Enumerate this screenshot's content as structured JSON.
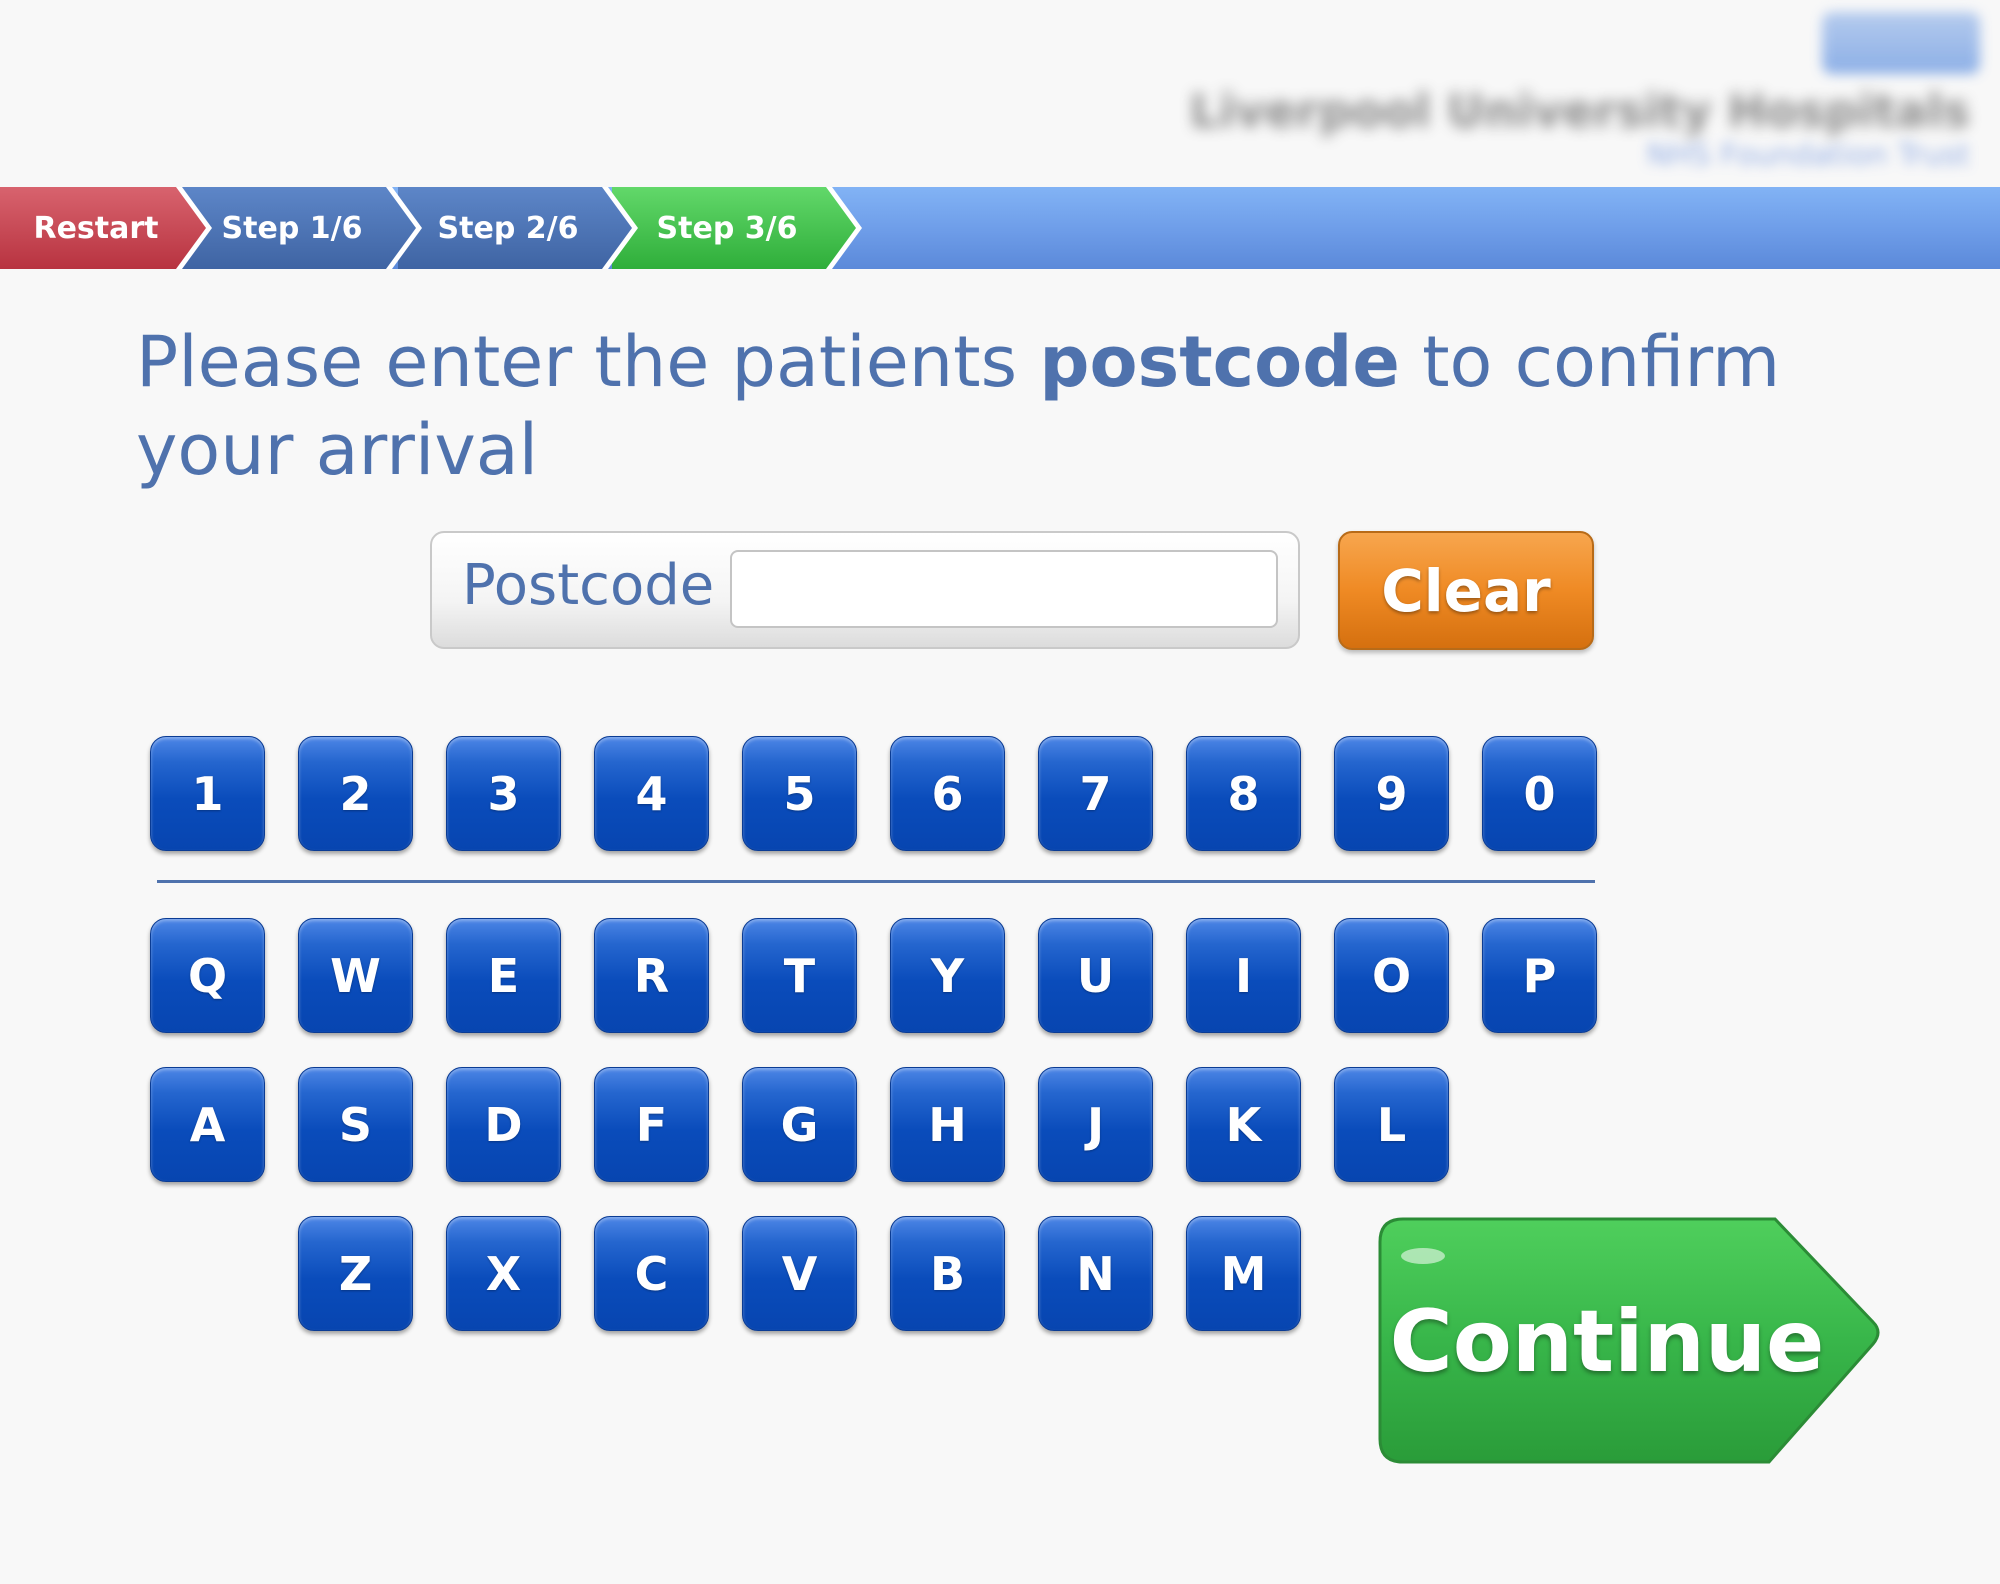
{
  "header": {
    "org_name": "Liverpool University Hospitals",
    "org_sub": "NHS Foundation Trust"
  },
  "steps": {
    "restart": "Restart",
    "step1": "Step 1/6",
    "step2": "Step 2/6",
    "step3": "Step 3/6",
    "current": "Step 3/6"
  },
  "heading": {
    "before": "Please enter the patients ",
    "emphasis": "postcode",
    "after": " to confirm your arrival"
  },
  "postcode": {
    "label": "Postcode",
    "value": ""
  },
  "buttons": {
    "clear": "Clear",
    "continue": "Continue"
  },
  "keyboard": {
    "row_numbers": [
      "1",
      "2",
      "3",
      "4",
      "5",
      "6",
      "7",
      "8",
      "9",
      "0"
    ],
    "row_1": [
      "Q",
      "W",
      "E",
      "R",
      "T",
      "Y",
      "U",
      "I",
      "O",
      "P"
    ],
    "row_2": [
      "A",
      "S",
      "D",
      "F",
      "G",
      "H",
      "J",
      "K",
      "L"
    ],
    "row_3": [
      "Z",
      "X",
      "C",
      "V",
      "B",
      "N",
      "M"
    ]
  },
  "colors": {
    "restart": "#c0424d",
    "step_done": "#4a70b0",
    "step_current": "#3ec148",
    "key": "#0a4cbb",
    "clear": "#ef8a24",
    "continue": "#38b64a",
    "heading_text": "#4f72ad"
  }
}
